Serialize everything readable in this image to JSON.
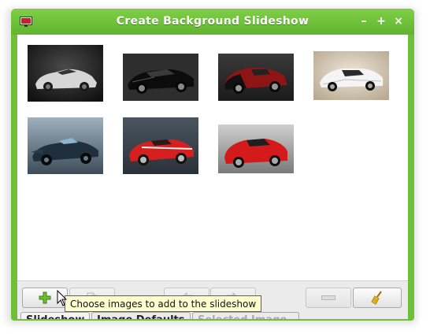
{
  "window": {
    "title": "Create Background Slideshow",
    "minimize_glyph": "–",
    "maximize_glyph": "+",
    "close_glyph": "×",
    "frame_color": "#6fbf3a"
  },
  "images": [
    {
      "name": "car-image-1",
      "description": "silver supercar on dark background"
    },
    {
      "name": "car-image-2",
      "description": "black sports car"
    },
    {
      "name": "car-image-3",
      "description": "red and black supercar"
    },
    {
      "name": "car-image-4",
      "description": "white race car"
    },
    {
      "name": "car-image-5",
      "description": "blue prototype race car"
    },
    {
      "name": "car-image-6",
      "description": "red sports car"
    },
    {
      "name": "car-image-7",
      "description": "red grand tourer"
    }
  ],
  "toolbar": {
    "add_icon": "plus-icon",
    "copy_icon": "copy-icon",
    "back_icon": "arrow-left-icon",
    "forward_icon": "arrow-right-icon",
    "remove_icon": "minus-icon",
    "clear_icon": "broom-icon"
  },
  "tabs": [
    {
      "label": "Slideshow",
      "state": "active"
    },
    {
      "label": "Image Defaults",
      "state": "normal"
    },
    {
      "label": "Selected Image",
      "state": "disabled"
    }
  ],
  "tooltip": {
    "text": "Choose images to add to the slideshow"
  }
}
